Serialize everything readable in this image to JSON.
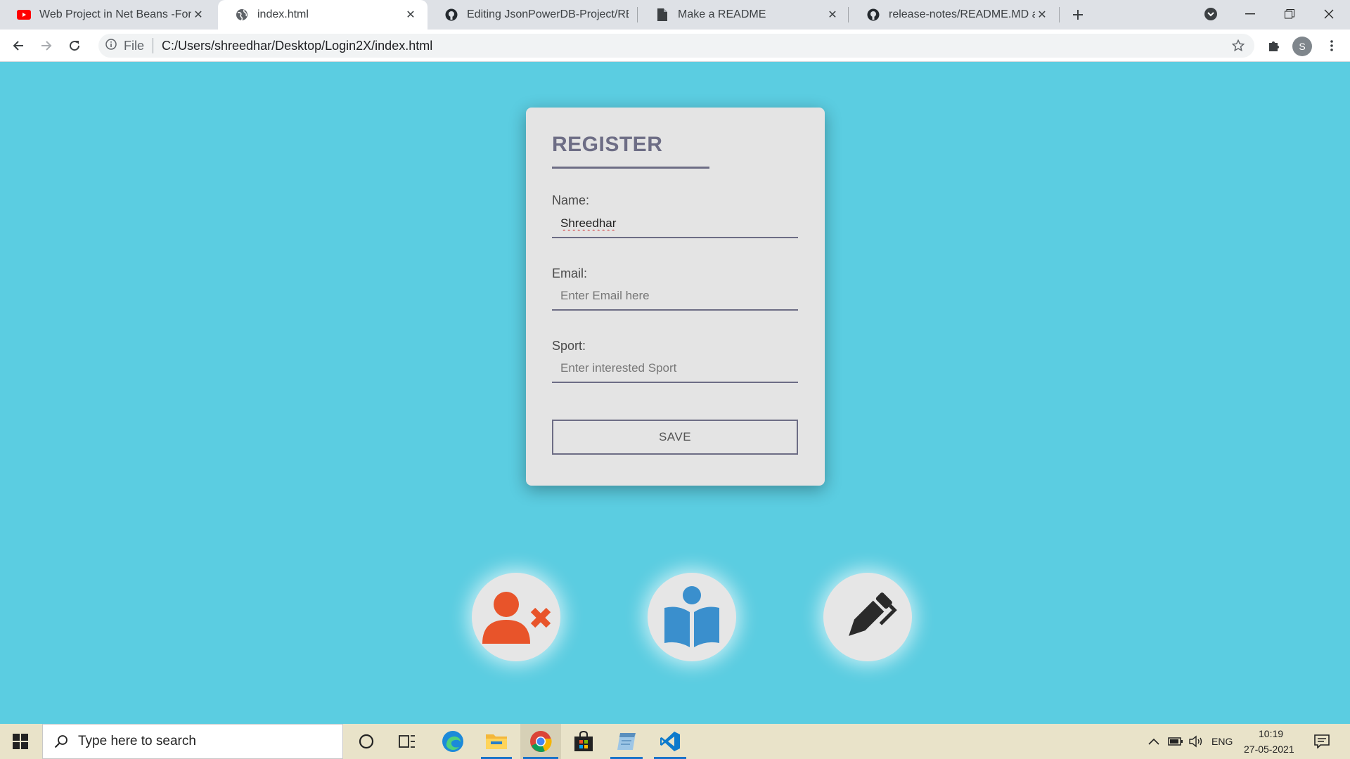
{
  "browser": {
    "tabs": [
      {
        "title": "Web Project in Net Beans -Form Validation",
        "icon": "youtube-icon"
      },
      {
        "title": "index.html",
        "icon": "globe-icon"
      },
      {
        "title": "Editing JsonPowerDB-Project/README.md",
        "icon": "github-icon"
      },
      {
        "title": "Make a README",
        "icon": "document-icon"
      },
      {
        "title": "release-notes/README.MD at main",
        "icon": "github-icon"
      }
    ],
    "address": {
      "scheme": "File",
      "url": "C:/Users/shreedhar/Desktop/Login2X/index.html"
    },
    "profile_initial": "S"
  },
  "form": {
    "title": "REGISTER",
    "name_label": "Name:",
    "name_value": "Shreedhar",
    "email_label": "Email:",
    "email_placeholder": "Enter Email here",
    "sport_label": "Sport:",
    "sport_placeholder": "Enter interested Sport",
    "save_label": "SAVE"
  },
  "actions": [
    {
      "icon": "user-remove-icon"
    },
    {
      "icon": "reader-icon"
    },
    {
      "icon": "pen-icon"
    }
  ],
  "taskbar": {
    "search_placeholder": "Type here to search",
    "language": "ENG",
    "time": "10:19",
    "date": "27-05-2021"
  },
  "colors": {
    "page_background": "#5bcde1",
    "card_background": "#e4e4e4",
    "accent": "#6d6d85",
    "delete_icon": "#e8542a",
    "reader_icon": "#3a8fcd",
    "pen_icon": "#2a2a2a"
  }
}
